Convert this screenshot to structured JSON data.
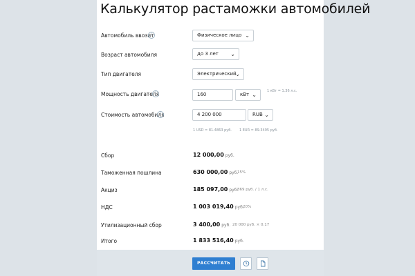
{
  "title": "Калькулятор растаможки автомобилей",
  "form": {
    "importer": {
      "label": "Автомобиль ввозит",
      "value": "Физическое лицо"
    },
    "age": {
      "label": "Возраст автомобиля",
      "value": "до 3 лет"
    },
    "engine_type": {
      "label": "Тип двигателя",
      "value": "Электрический"
    },
    "power": {
      "label": "Мощность двигателя",
      "value": "160",
      "unit": "кВт",
      "hint": "1 кВт = 1.36 л.с."
    },
    "price": {
      "label": "Стоимость автомобиля",
      "value": "4 200 000",
      "currency": "RUB",
      "rate_usd": "1 USD = 81.4863 руб.",
      "rate_eur": "1 EUR = 89.3495 руб."
    }
  },
  "results": [
    {
      "label": "Сбор",
      "value": "12 000,00",
      "unit": "руб.",
      "note": ""
    },
    {
      "label": "Таможенная пошлина",
      "value": "630 000,00",
      "unit": "руб.",
      "note": "15%"
    },
    {
      "label": "Акциз",
      "value": "185 097,00",
      "unit": "руб.",
      "note": "869 руб. / 1 л.с."
    },
    {
      "label": "НДС",
      "value": "1 003 019,40",
      "unit": "руб.",
      "note": "20%"
    },
    {
      "label": "Утилизационный сбор",
      "value": "3 400,00",
      "unit": "руб.",
      "note": "20 000 руб. × 0.17"
    },
    {
      "label": "Итого",
      "value": "1 833 516,40",
      "unit": "руб.",
      "note": ""
    }
  ],
  "actions": {
    "calculate_label": "РАССЧИТАТЬ",
    "history_icon": "clock-icon",
    "document_icon": "document-icon"
  },
  "colors": {
    "accent": "#2f7fd1",
    "background": "#dde3e8",
    "panel": "#ffffff"
  }
}
